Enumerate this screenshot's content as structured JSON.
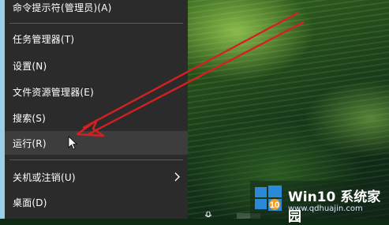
{
  "menu": {
    "items": [
      {
        "label": "命令提示符(管理员)(A)"
      },
      {
        "label": "任务管理器(T)"
      },
      {
        "label": "设置(N)"
      },
      {
        "label": "文件资源管理器(E)"
      },
      {
        "label": "搜索(S)"
      },
      {
        "label": "运行(R)"
      },
      {
        "label": "关机或注销(U)"
      },
      {
        "label": "桌面(D)"
      }
    ],
    "hovered_item": "运行(R)"
  },
  "watermark": {
    "title": "Win10 系统家园",
    "url": "www.qdhuajin.com",
    "logo_icon": "win10-logo-icon"
  },
  "colors": {
    "menu_bg": "#2b2b2b",
    "hover_bg": "#3d3d3d",
    "arrow": "#d42020"
  },
  "icons": [
    "submenu-chevron-icon",
    "mouse-cursor-icon",
    "red-annotation-arrow-icon",
    "microphone-icon"
  ]
}
